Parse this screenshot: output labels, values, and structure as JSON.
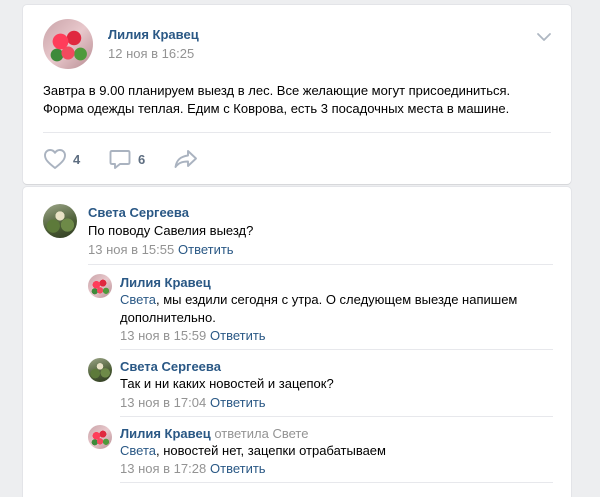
{
  "post": {
    "author": "Лилия Кравец",
    "date": "12 ноя в 16:25",
    "text_line1": "Завтра в 9.00 планируем выезд в лес. Все желающие могут присоединиться.",
    "text_line2": "Форма одежды теплая. Едим с Коврова, есть 3 посадочных места в машине.",
    "likes": "4",
    "comments": "6"
  },
  "comments": [
    {
      "author": "Света Сергеева",
      "text": "По поводу Савелия выезд?",
      "date": "13 ноя в 15:55",
      "reply_label": "Ответить"
    },
    {
      "author": "Лилия Кравец",
      "mention": "Света",
      "text_rest": ", мы ездили сегодня с утра. О следующем выезде напишем",
      "text_line2": "дополнительно.",
      "date": "13 ноя в 15:59",
      "reply_label": "Ответить"
    },
    {
      "author": "Света Сергеева",
      "text": "Так и ни каких новостей и зацепок?",
      "date": "13 ноя в 17:04",
      "reply_label": "Ответить"
    },
    {
      "author": "Лилия Кравец",
      "reply_to": "ответила Свете",
      "mention": "Света",
      "text_rest": ", новостей нет, зацепки отрабатываем",
      "date": "13 ноя в 17:28",
      "reply_label": "Ответить"
    }
  ]
}
